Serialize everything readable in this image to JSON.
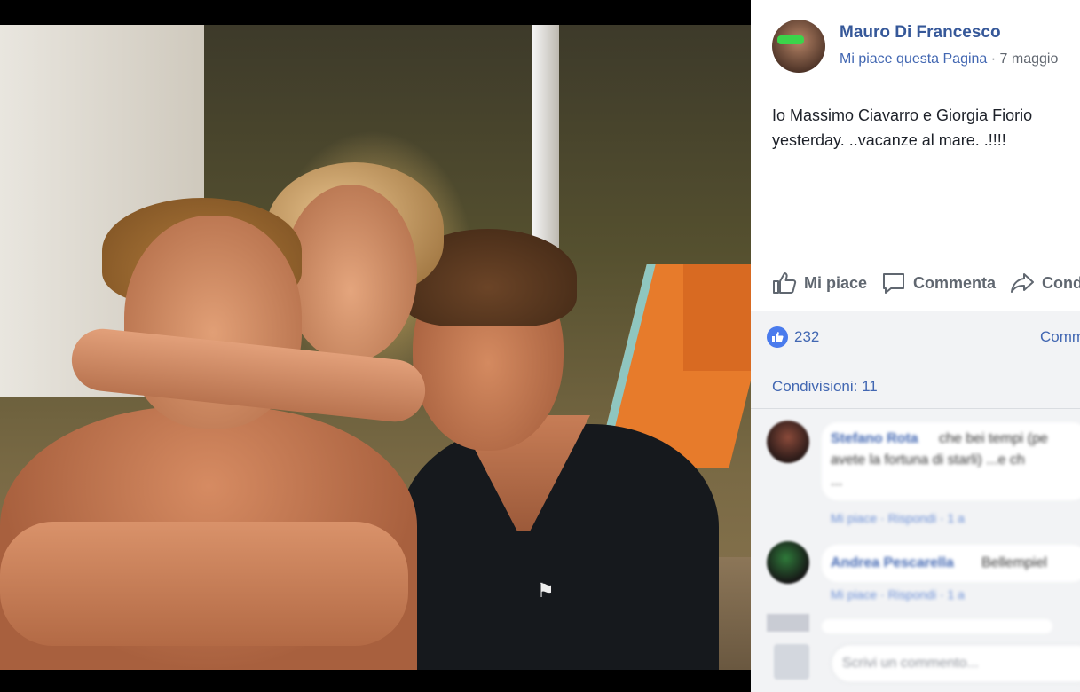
{
  "post": {
    "author": "Mauro Di Francesco",
    "page_like": "Mi piace questa Pagina",
    "meta_separator": " · ",
    "date": "7 maggio",
    "text": "Io Massimo Ciavarro e Giorgia Fiorio\nyesterday. ..vacanze al mare. .!!!!"
  },
  "actions": {
    "like": "Mi piace",
    "comment": "Commenta",
    "share": "Condividi"
  },
  "stats": {
    "reactions": "232",
    "comments_label": "Commenti",
    "shares": "Condivisioni: 11"
  },
  "comments": [
    {
      "name": "Stefano Rota",
      "text_line1": "che bei tempi (pe",
      "text_line2": "avete la fortuna di starli) ...e ch",
      "text_line3": "...",
      "footer": "Mi piace · Rispondi · 1 a"
    },
    {
      "name": "Andrea Pescarella",
      "text_line1": "Bellempiel",
      "footer": "Mi piace · Rispondi · 1 a"
    }
  ],
  "compose_placeholder": "Scrivi un commento...",
  "colors": {
    "link_blue": "#365899",
    "action_grey": "#606770",
    "panel_bg": "#ffffff",
    "feed_grey": "#f2f3f5",
    "like_blue": "#4a7bed"
  }
}
